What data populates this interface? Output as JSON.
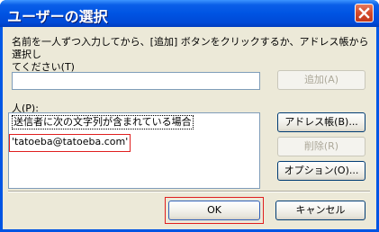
{
  "window": {
    "title": "ユーザーの選択",
    "close_icon": "close-icon"
  },
  "instructions": {
    "line1": "名前を一人ずつ入力してから、[追加] ボタンをクリックするか、アドレス帳から選択し",
    "line2": "てください(T)"
  },
  "name_input": {
    "value": "",
    "placeholder": ""
  },
  "buttons": {
    "add": "追加(A)",
    "address_book": "アドレス帳(B)...",
    "delete": "削除(R)",
    "options": "オプション(O)...",
    "ok": "OK",
    "cancel": "キャンセル"
  },
  "people": {
    "label": "人(P):",
    "items": [
      "送信者に次の文字列が含まれている場合",
      "'tatoeba@tatoeba.com'"
    ]
  },
  "colors": {
    "titlebar": "#0054e3",
    "face": "#ece9d8",
    "highlight_box": "#e01f1f"
  }
}
